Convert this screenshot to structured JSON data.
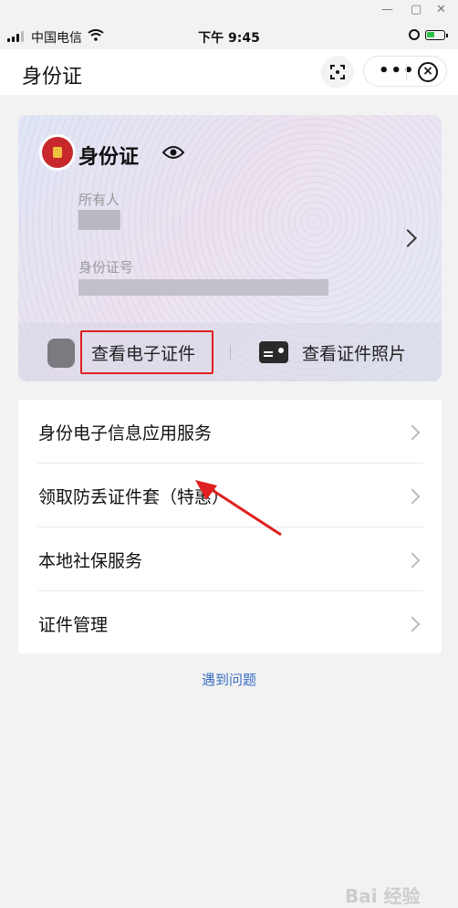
{
  "status_bar": {
    "carrier": "中国电信",
    "time": "下午 9:45",
    "battery_level": 0.45
  },
  "nav": {
    "title": "身份证",
    "more_label": "•••",
    "close_label": "×"
  },
  "card": {
    "title": "身份证",
    "owner_label": "所有人",
    "id_label": "身份证号",
    "view_ecert": "查看电子证件",
    "view_photo": "查看证件照片"
  },
  "menu": [
    {
      "label": "身份电子信息应用服务"
    },
    {
      "label": "领取防丢证件套（特惠）"
    },
    {
      "label": "本地社保服务"
    },
    {
      "label": "证件管理"
    }
  ],
  "problem_link": "遇到问题",
  "watermark": "Bai 经验",
  "colors": {
    "highlight": "#e02020",
    "link": "#3a6fc4",
    "emblem": "#c7282c"
  }
}
